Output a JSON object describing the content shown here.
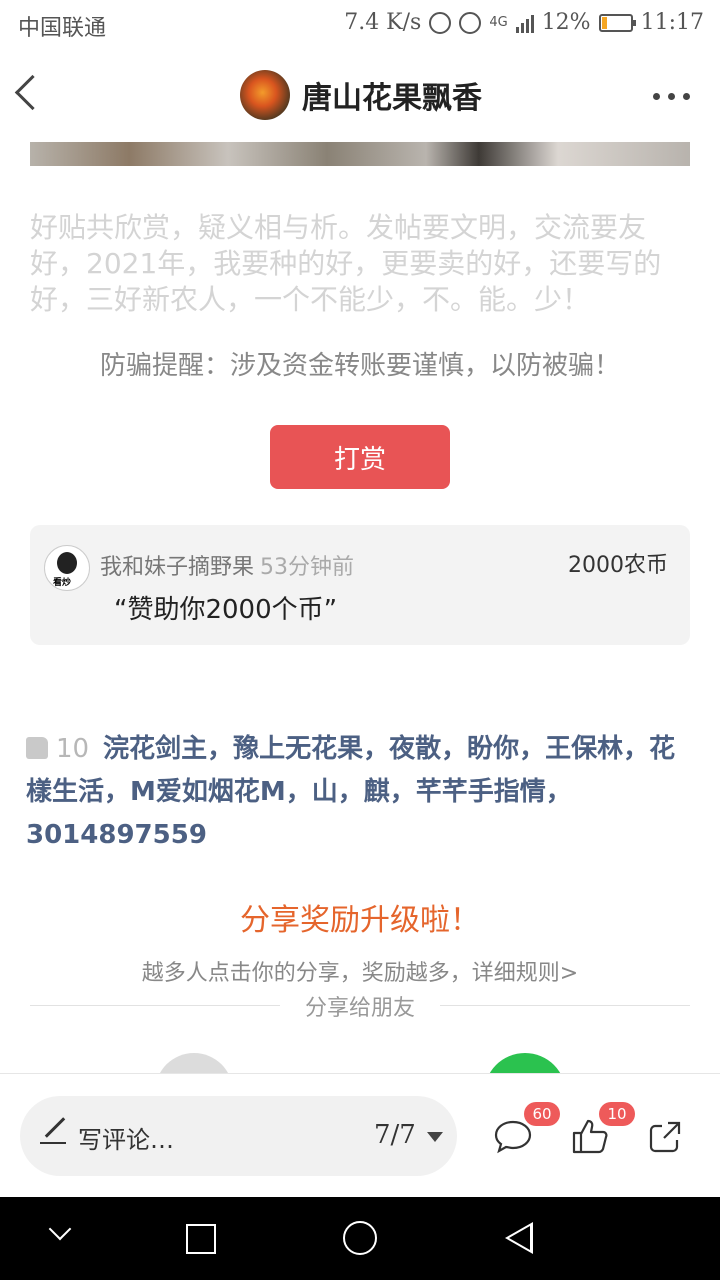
{
  "status_bar": {
    "carrier": "中国联通",
    "speed": "7.4 K/s",
    "network": "4G",
    "battery": "12%",
    "time": "11:17"
  },
  "header": {
    "title": "唐山花果飘香"
  },
  "post": {
    "faded_text": "好贴共欣赏，疑义相与析。发帖要文明，交流要友好，2021年，我要种的好，更要卖的好，还要写的好，三好新农人，一个不能少，不。能。少！",
    "warning": "防骗提醒：涉及资金转账要谨慎，以防被骗！",
    "reward_button": "打赏"
  },
  "donation": {
    "avatar_tag": "看炒",
    "name": "我和妹子摘野果",
    "time": "53分钟前",
    "amount": "2000农币",
    "message": "“赞助你2000个币”"
  },
  "likes": {
    "count": "10",
    "names": "浣花剑主，豫上无花果，夜散，盼你，王保林，花樣生活，M爱如烟花M，山，麒，芊芊手指情，3014897559"
  },
  "share": {
    "title": "分享奖励升级啦！",
    "subtitle": "越多人点击你的分享，奖励越多，详细规则>",
    "to_friends": "分享给朋友"
  },
  "bottom_bar": {
    "comment_placeholder": "写评论…",
    "page_indicator": "7/7",
    "comment_count": "60",
    "like_count": "10"
  },
  "colors": {
    "accent_red": "#e85455",
    "share_orange": "#e5652c",
    "link_blue": "#4c6083"
  }
}
